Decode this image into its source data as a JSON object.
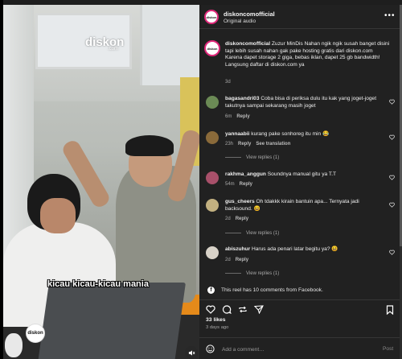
{
  "video": {
    "brand_name": "diskon",
    "brand_suffix": ".com",
    "caption": "kicau kicau-kicau mania",
    "watermark_label": "diskon"
  },
  "header": {
    "username": "diskoncomofficial",
    "audio": "Original audio",
    "more_label": "•••"
  },
  "main_comment": {
    "username": "diskoncomofficial",
    "text": "Zuzur MinDis Nahan ngik ngik susah banget disini tapi lebih susah nahan gak pake hosting gratis dari diskon.com",
    "text2": "Karena dapet storage 2 giga, bebas iklan, dapet 25 gb bandwidth! Langsung daftar di diskon.com ya",
    "time": "3d"
  },
  "comments": [
    {
      "username": "bagasandri03",
      "text": "Coba bisa di periksa dulu itu kak yang joget-joget takutnya sampai sekarang masih joget",
      "time": "6m",
      "reply": "Reply",
      "extra": "",
      "avatar_color": "#6b8a55"
    },
    {
      "username": "yannaabii",
      "text": "kurang pake sonhoreg itu min 😂",
      "time": "23h",
      "reply": "Reply",
      "extra": "See translation",
      "avatar_color": "#8a6a3a",
      "replies": "View replies (1)"
    },
    {
      "username": "rakhma_anggun",
      "text": "Soundnya manual gitu ya T.T",
      "time": "54m",
      "reply": "Reply",
      "extra": "",
      "avatar_color": "#a8506a"
    },
    {
      "username": "gus_cheers",
      "text": "Oh tdakkk kirain bantuin apa... Ternyata jadi backsound. 😆",
      "time": "2d",
      "reply": "Reply",
      "extra": "",
      "avatar_color": "#c2b080",
      "replies": "View replies (1)"
    },
    {
      "username": "abiszuhur",
      "text": "Harus ada penari latar begitu ya? 😆",
      "time": "2d",
      "reply": "Reply",
      "extra": "",
      "avatar_color": "#d8d2c8",
      "replies": "View replies (1)"
    }
  ],
  "fb_note": "This reel has 10 comments from Facebook.",
  "likes": "33 likes",
  "ago": "3 days ago",
  "add_comment": {
    "placeholder": "Add a comment…",
    "post": "Post"
  },
  "colors": {
    "background": "#212121",
    "muted": "#a8a8a8",
    "story_ring": "#e0287a"
  }
}
